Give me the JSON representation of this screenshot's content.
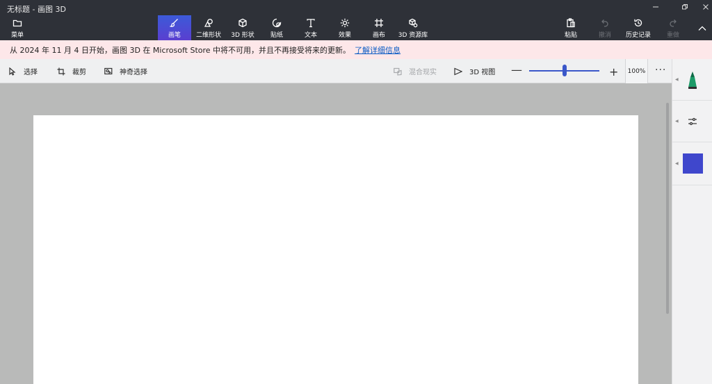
{
  "window": {
    "title": "无标题 - 画图 3D"
  },
  "ribbon": {
    "menu": "菜单",
    "tabs": [
      {
        "label": "画笔",
        "icon": "brush-icon",
        "active": true
      },
      {
        "label": "二维形状",
        "icon": "shapes-2d-icon"
      },
      {
        "label": "3D 形状",
        "icon": "cube-icon"
      },
      {
        "label": "贴纸",
        "icon": "sticker-icon"
      },
      {
        "label": "文本",
        "icon": "text-icon"
      },
      {
        "label": "效果",
        "icon": "sun-icon"
      },
      {
        "label": "画布",
        "icon": "canvas-icon"
      },
      {
        "label": "3D 资源库",
        "icon": "library-icon"
      }
    ],
    "paste": "粘贴",
    "undo": "撤消",
    "history": "历史记录",
    "redo": "重做"
  },
  "notice": {
    "text": "从 2024 年 11 月 4 日开始，画图 3D 在 Microsoft Store 中将不可用，并且不再接受将来的更新。",
    "link": "了解详细信息"
  },
  "toolbar": {
    "select": "选择",
    "crop": "裁剪",
    "magic_select": "神奇选择",
    "mixed_reality": "混合现实",
    "view_3d": "3D 视图",
    "zoom_percent": "100%",
    "more": "···"
  },
  "zoom": {
    "value_fraction": 0.5
  },
  "colors": {
    "accent": "#3f47cc",
    "selected_color": "#3f47cc",
    "marker_green": "#1d9b68"
  }
}
